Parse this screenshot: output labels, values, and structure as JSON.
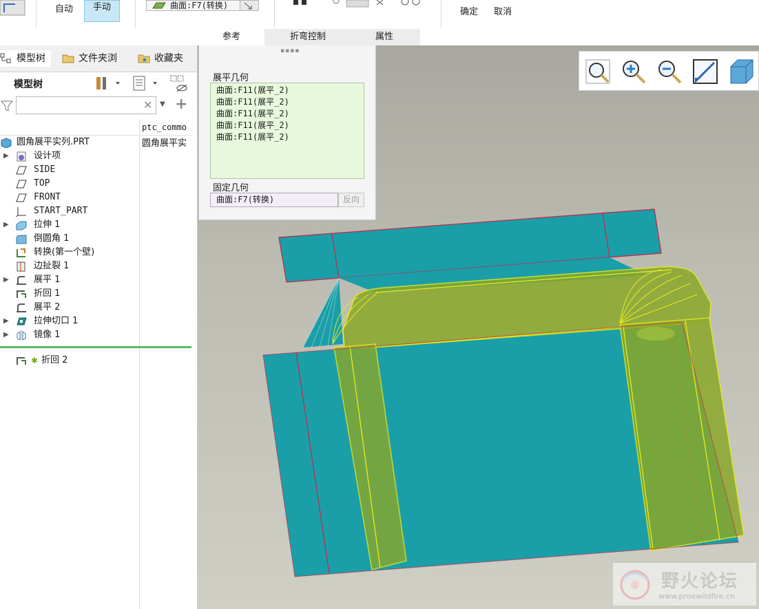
{
  "ribbon": {
    "auto_label": "自动",
    "manual_label": "手动",
    "selection_value": "曲面:F7(转换)",
    "ok_label": "确定",
    "cancel_label": "取消",
    "tabs": [
      "参考",
      "折弯控制",
      "属性"
    ]
  },
  "left_tabs": {
    "model_tree": "模型树",
    "folder_browser": "文件夹浏",
    "favorites": "收藏夹"
  },
  "tree": {
    "title": "模型树",
    "filter_placeholder": "",
    "column_header": "ptc_commo",
    "root": "圆角展平实列.PRT",
    "root_col2": "圆角展平实",
    "items": [
      {
        "label": "设计项",
        "expandable": true,
        "icon": "design-items-icon"
      },
      {
        "label": "SIDE",
        "expandable": false,
        "icon": "datum-plane-icon"
      },
      {
        "label": "TOP",
        "expandable": false,
        "icon": "datum-plane-icon"
      },
      {
        "label": "FRONT",
        "expandable": false,
        "icon": "datum-plane-icon"
      },
      {
        "label": "START_PART",
        "expandable": false,
        "icon": "coordinate-system-icon"
      },
      {
        "label": "拉伸 1",
        "expandable": true,
        "icon": "extrude-icon"
      },
      {
        "label": "倒圆角 1",
        "expandable": false,
        "icon": "round-icon"
      },
      {
        "label": "转换(第一个壁)",
        "expandable": false,
        "icon": "convert-icon"
      },
      {
        "label": "边扯裂 1",
        "expandable": false,
        "icon": "edge-rip-icon"
      },
      {
        "label": "展平 1",
        "expandable": true,
        "icon": "unbend-icon"
      },
      {
        "label": "折回 1",
        "expandable": false,
        "icon": "bend-back-icon"
      },
      {
        "label": "展平 2",
        "expandable": false,
        "icon": "unbend-icon"
      },
      {
        "label": "拉伸切口 1",
        "expandable": true,
        "icon": "extrude-cut-icon"
      },
      {
        "label": "镜像 1",
        "expandable": true,
        "icon": "mirror-icon"
      }
    ],
    "active_item": "折回 2"
  },
  "ref_panel": {
    "unfold_geometry_label": "展平几何",
    "unfold_geometry_items": [
      "曲面:F11(展平_2)",
      "曲面:F11(展平_2)",
      "曲面:F11(展平_2)",
      "曲面:F11(展平_2)",
      "曲面:F11(展平_2)"
    ],
    "fixed_geometry_label": "固定几何",
    "fixed_geometry_value": "曲面:F7(转换)",
    "flip_label": "反向"
  },
  "view_toolbar": [
    "refit-icon",
    "zoom-in-icon",
    "zoom-out-icon",
    "repaint-icon",
    "saved-views-icon"
  ],
  "watermark": {
    "title": "野火论坛",
    "url": "www.proewildfire.cn"
  },
  "colors": {
    "sheet_metal": "#1a9ea8",
    "bend_highlight": "#e8ea1a",
    "edge_red": "#c8284a",
    "preview_green": "#8aa82a",
    "selected_tab": "#c8e8f8"
  }
}
